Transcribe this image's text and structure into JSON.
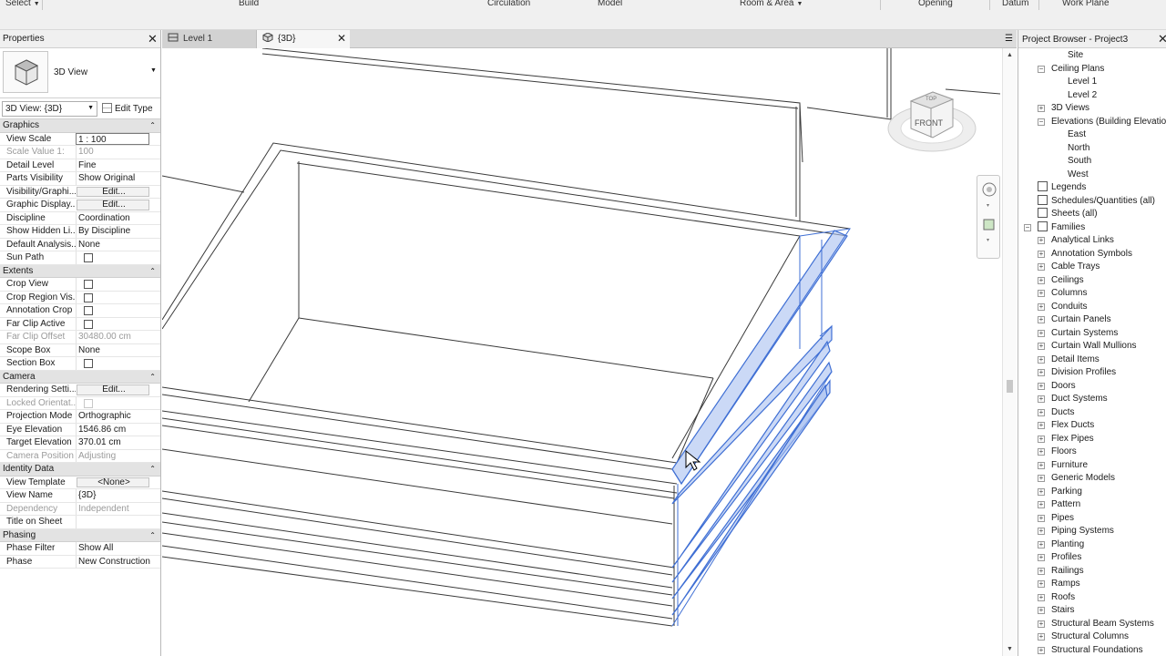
{
  "ribbon": {
    "panels": [
      {
        "label": "Select",
        "has_dropdown": true
      },
      {
        "label": "Build",
        "has_dropdown": false
      },
      {
        "label": "Circulation",
        "has_dropdown": false
      },
      {
        "label": "Model",
        "has_dropdown": false
      },
      {
        "label": "Room & Area",
        "has_dropdown": true
      },
      {
        "label": "Opening",
        "has_dropdown": false
      },
      {
        "label": "Datum",
        "has_dropdown": false
      },
      {
        "label": "Work Plane",
        "has_dropdown": false
      }
    ]
  },
  "properties": {
    "title": "Properties",
    "type_name": "3D View",
    "view_selector": "3D View: {3D}",
    "edit_type_label": "Edit Type",
    "groups": [
      {
        "name": "Graphics",
        "rows": [
          {
            "name": "View Scale",
            "value": "1 : 100",
            "kind": "field"
          },
          {
            "name": "Scale Value    1:",
            "value": "100",
            "kind": "text",
            "dim": true
          },
          {
            "name": "Detail Level",
            "value": "Fine",
            "kind": "text"
          },
          {
            "name": "Parts Visibility",
            "value": "Show Original",
            "kind": "text"
          },
          {
            "name": "Visibility/Graphi...",
            "value": "Edit...",
            "kind": "button"
          },
          {
            "name": "Graphic Display...",
            "value": "Edit...",
            "kind": "button"
          },
          {
            "name": "Discipline",
            "value": "Coordination",
            "kind": "text"
          },
          {
            "name": "Show Hidden Li...",
            "value": "By Discipline",
            "kind": "text"
          },
          {
            "name": "Default Analysis...",
            "value": "None",
            "kind": "text"
          },
          {
            "name": "Sun Path",
            "value": "",
            "kind": "checkbox"
          }
        ]
      },
      {
        "name": "Extents",
        "rows": [
          {
            "name": "Crop View",
            "value": "",
            "kind": "checkbox"
          },
          {
            "name": "Crop Region Vis...",
            "value": "",
            "kind": "checkbox"
          },
          {
            "name": "Annotation Crop",
            "value": "",
            "kind": "checkbox"
          },
          {
            "name": "Far Clip Active",
            "value": "",
            "kind": "checkbox"
          },
          {
            "name": "Far Clip Offset",
            "value": "30480.00 cm",
            "kind": "text",
            "dim": true
          },
          {
            "name": "Scope Box",
            "value": "None",
            "kind": "text"
          },
          {
            "name": "Section Box",
            "value": "",
            "kind": "checkbox"
          }
        ]
      },
      {
        "name": "Camera",
        "rows": [
          {
            "name": "Rendering Setti...",
            "value": "Edit...",
            "kind": "button"
          },
          {
            "name": "Locked Orientat...",
            "value": "",
            "kind": "checkbox",
            "dim": true
          },
          {
            "name": "Projection Mode",
            "value": "Orthographic",
            "kind": "text"
          },
          {
            "name": "Eye Elevation",
            "value": "1546.86 cm",
            "kind": "text"
          },
          {
            "name": "Target Elevation",
            "value": "370.01 cm",
            "kind": "text"
          },
          {
            "name": "Camera Position",
            "value": "Adjusting",
            "kind": "text",
            "dim": true
          }
        ]
      },
      {
        "name": "Identity Data",
        "rows": [
          {
            "name": "View Template",
            "value": "<None>",
            "kind": "button"
          },
          {
            "name": "View Name",
            "value": "{3D}",
            "kind": "text"
          },
          {
            "name": "Dependency",
            "value": "Independent",
            "kind": "text",
            "dim": true
          },
          {
            "name": "Title on Sheet",
            "value": "",
            "kind": "text"
          }
        ]
      },
      {
        "name": "Phasing",
        "rows": [
          {
            "name": "Phase Filter",
            "value": "Show All",
            "kind": "text"
          },
          {
            "name": "Phase",
            "value": "New Construction",
            "kind": "text"
          }
        ]
      }
    ]
  },
  "tabs": [
    {
      "label": "Level 1",
      "active": false
    },
    {
      "label": "{3D}",
      "active": true
    }
  ],
  "viewcube": {
    "face_label": "FRONT",
    "top_label": "TOP"
  },
  "browser": {
    "title": "Project Browser - Project3",
    "items": [
      {
        "label": "Site",
        "level": 3,
        "expander": ""
      },
      {
        "label": "Ceiling Plans",
        "level": 2,
        "expander": "-"
      },
      {
        "label": "Level 1",
        "level": 3,
        "expander": ""
      },
      {
        "label": "Level 2",
        "level": 3,
        "expander": ""
      },
      {
        "label": "3D Views",
        "level": 2,
        "expander": "+"
      },
      {
        "label": "Elevations (Building Elevation)",
        "level": 2,
        "expander": "-"
      },
      {
        "label": "East",
        "level": 3,
        "expander": ""
      },
      {
        "label": "North",
        "level": 3,
        "expander": ""
      },
      {
        "label": "South",
        "level": 3,
        "expander": ""
      },
      {
        "label": "West",
        "level": 3,
        "expander": ""
      },
      {
        "label": "Legends",
        "level": 1,
        "expander": "",
        "icon": true
      },
      {
        "label": "Schedules/Quantities (all)",
        "level": 1,
        "expander": "",
        "icon": true
      },
      {
        "label": "Sheets (all)",
        "level": 1,
        "expander": "",
        "icon": true
      },
      {
        "label": "Families",
        "level": 1,
        "expander": "-",
        "icon": true
      },
      {
        "label": "Analytical Links",
        "level": 2,
        "expander": "+"
      },
      {
        "label": "Annotation Symbols",
        "level": 2,
        "expander": "+"
      },
      {
        "label": "Cable Trays",
        "level": 2,
        "expander": "+"
      },
      {
        "label": "Ceilings",
        "level": 2,
        "expander": "+"
      },
      {
        "label": "Columns",
        "level": 2,
        "expander": "+"
      },
      {
        "label": "Conduits",
        "level": 2,
        "expander": "+"
      },
      {
        "label": "Curtain Panels",
        "level": 2,
        "expander": "+"
      },
      {
        "label": "Curtain Systems",
        "level": 2,
        "expander": "+"
      },
      {
        "label": "Curtain Wall Mullions",
        "level": 2,
        "expander": "+"
      },
      {
        "label": "Detail Items",
        "level": 2,
        "expander": "+"
      },
      {
        "label": "Division Profiles",
        "level": 2,
        "expander": "+"
      },
      {
        "label": "Doors",
        "level": 2,
        "expander": "+"
      },
      {
        "label": "Duct Systems",
        "level": 2,
        "expander": "+"
      },
      {
        "label": "Ducts",
        "level": 2,
        "expander": "+"
      },
      {
        "label": "Flex Ducts",
        "level": 2,
        "expander": "+"
      },
      {
        "label": "Flex Pipes",
        "level": 2,
        "expander": "+"
      },
      {
        "label": "Floors",
        "level": 2,
        "expander": "+"
      },
      {
        "label": "Furniture",
        "level": 2,
        "expander": "+"
      },
      {
        "label": "Generic Models",
        "level": 2,
        "expander": "+"
      },
      {
        "label": "Parking",
        "level": 2,
        "expander": "+"
      },
      {
        "label": "Pattern",
        "level": 2,
        "expander": "+"
      },
      {
        "label": "Pipes",
        "level": 2,
        "expander": "+"
      },
      {
        "label": "Piping Systems",
        "level": 2,
        "expander": "+"
      },
      {
        "label": "Planting",
        "level": 2,
        "expander": "+"
      },
      {
        "label": "Profiles",
        "level": 2,
        "expander": "+"
      },
      {
        "label": "Railings",
        "level": 2,
        "expander": "+"
      },
      {
        "label": "Ramps",
        "level": 2,
        "expander": "+"
      },
      {
        "label": "Roofs",
        "level": 2,
        "expander": "+"
      },
      {
        "label": "Stairs",
        "level": 2,
        "expander": "+"
      },
      {
        "label": "Structural Beam Systems",
        "level": 2,
        "expander": "+"
      },
      {
        "label": "Structural Columns",
        "level": 2,
        "expander": "+"
      },
      {
        "label": "Structural Foundations",
        "level": 2,
        "expander": "+"
      }
    ]
  },
  "colors": {
    "selection": "#3f6fd4",
    "selection_fill": "#a9bff0"
  }
}
